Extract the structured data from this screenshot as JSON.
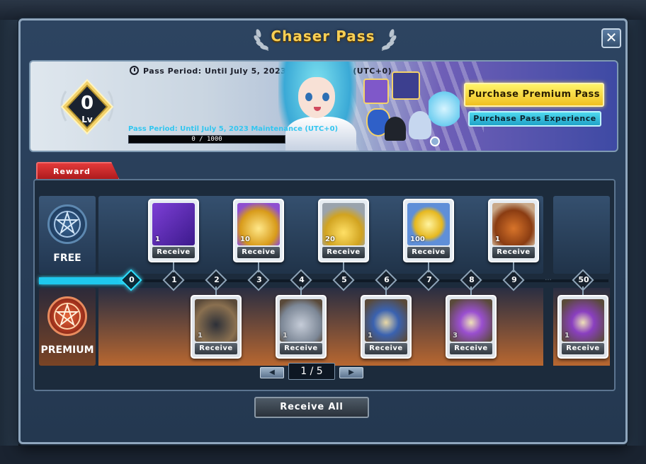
{
  "window": {
    "title": "Chaser Pass",
    "close_label": "✕"
  },
  "banner": {
    "level": "0",
    "level_suffix": "Lv",
    "period_text": "Pass Period: Until July 5, 2023 Maintenance (UTC+0)",
    "period_sub": "Pass Period: Until July 5, 2023 Maintenance (UTC+0)",
    "xp_text": "0 / 1000",
    "xp_progress": 0,
    "buttons": {
      "premium": "Purchase Premium Pass",
      "experience": "Purchase Pass Experience"
    }
  },
  "tab": {
    "reward": "Reward"
  },
  "rows": {
    "free_label": "FREE",
    "premium_label": "PREMIUM"
  },
  "track": {
    "current_level": 0,
    "levels": [
      "0",
      "1",
      "2",
      "3",
      "4",
      "5",
      "6",
      "7",
      "8",
      "9",
      "50"
    ]
  },
  "free_rewards": [
    {
      "level": "1",
      "qty": "1",
      "icon": "purple-bag-icon",
      "button": "Receive"
    },
    {
      "level": "3",
      "qty": "10",
      "icon": "gold-chest-icon",
      "button": "Receive"
    },
    {
      "level": "5",
      "qty": "20",
      "icon": "potion-icon",
      "button": "Receive"
    },
    {
      "level": "7",
      "qty": "100",
      "icon": "gold-coin-icon",
      "button": "Receive"
    },
    {
      "level": "9",
      "qty": "1",
      "icon": "treasure-chest-icon",
      "button": "Receive"
    }
  ],
  "premium_rewards": [
    {
      "level": "2",
      "qty": "1",
      "icon": "hat-box-icon",
      "button": "Receive"
    },
    {
      "level": "4",
      "qty": "1",
      "icon": "character-duo-icon",
      "button": "Receive"
    },
    {
      "level": "6",
      "qty": "1",
      "icon": "map-scroll-icon",
      "button": "Receive"
    },
    {
      "level": "8",
      "qty": "3",
      "icon": "coupon-scroll-icon",
      "button": "Receive"
    },
    {
      "level": "50",
      "qty": "1",
      "icon": "ticket-scroll-icon",
      "button": "Receive"
    }
  ],
  "pager": {
    "prev": "◀",
    "next": "▶",
    "page_text": "1 / 5"
  },
  "footer": {
    "receive_all": "Receive All"
  },
  "colors": {
    "title": "#f7cf55",
    "premium_button": "#f7de3a",
    "experience_button": "#38c3e0",
    "progress": "#1ec8ee",
    "tab_red": "#d22a2a"
  }
}
